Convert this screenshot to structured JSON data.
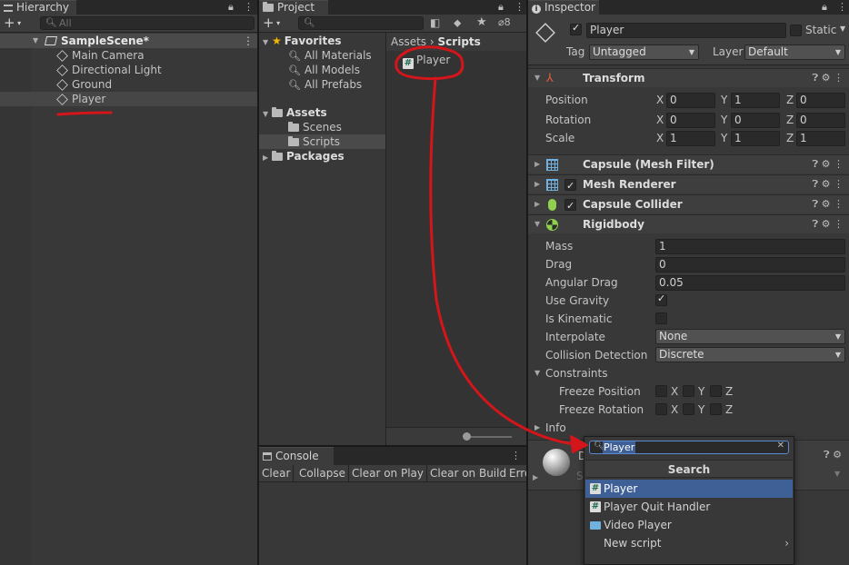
{
  "hierarchy": {
    "tab_label": "Hierarchy",
    "search_placeholder": "All",
    "scene_name": "SampleScene*",
    "items": [
      {
        "label": "Main Camera"
      },
      {
        "label": "Directional Light"
      },
      {
        "label": "Ground"
      },
      {
        "label": "Player"
      }
    ]
  },
  "project": {
    "tab_label": "Project",
    "hidden_count": "8",
    "favorites_label": "Favorites",
    "favorites": [
      {
        "label": "All Materials"
      },
      {
        "label": "All Models"
      },
      {
        "label": "All Prefabs"
      }
    ],
    "assets_label": "Assets",
    "asset_folders": [
      {
        "label": "Scenes"
      },
      {
        "label": "Scripts"
      }
    ],
    "packages_label": "Packages",
    "breadcrumb": {
      "root": "Assets",
      "sep": "›",
      "current": "Scripts"
    },
    "files": [
      {
        "label": "Player"
      }
    ]
  },
  "console": {
    "tab_label": "Console",
    "buttons": [
      "Clear",
      "Collapse",
      "Clear on Play",
      "Clear on Build",
      "Erro"
    ]
  },
  "inspector": {
    "tab_label": "Inspector",
    "object_name": "Player",
    "static_label": "Static",
    "tag_label": "Tag",
    "tag_value": "Untagged",
    "layer_label": "Layer",
    "layer_value": "Default",
    "transform": {
      "title": "Transform",
      "position_label": "Position",
      "rotation_label": "Rotation",
      "scale_label": "Scale",
      "position": {
        "x": "0",
        "y": "1",
        "z": "0"
      },
      "rotation": {
        "x": "0",
        "y": "0",
        "z": "0"
      },
      "scale": {
        "x": "1",
        "y": "1",
        "z": "1"
      }
    },
    "axis_labels": {
      "x": "X",
      "y": "Y",
      "z": "Z"
    },
    "components": [
      {
        "title": "Capsule (Mesh Filter)"
      },
      {
        "title": "Mesh Renderer"
      },
      {
        "title": "Capsule Collider"
      }
    ],
    "rigidbody": {
      "title": "Rigidbody",
      "mass_label": "Mass",
      "mass": "1",
      "drag_label": "Drag",
      "drag": "0",
      "angular_drag_label": "Angular Drag",
      "angular_drag": "0.05",
      "use_gravity_label": "Use Gravity",
      "is_kinematic_label": "Is Kinematic",
      "interpolate_label": "Interpolate",
      "interpolate": "None",
      "collision_detection_label": "Collision Detection",
      "collision_detection": "Discrete",
      "constraints_label": "Constraints",
      "freeze_position_label": "Freeze Position",
      "freeze_rotation_label": "Freeze Rotation",
      "info_label": "Info"
    },
    "material_partial": "D",
    "shader_partial": "S"
  },
  "add_component_popup": {
    "search_value": "Player",
    "header": "Search",
    "items": [
      {
        "label": "Player",
        "icon": "script-icon"
      },
      {
        "label": "Player Quit Handler",
        "icon": "script-icon"
      },
      {
        "label": "Video Player",
        "icon": "video-player-icon"
      },
      {
        "label": "New script",
        "icon": "chevron-right-icon"
      }
    ]
  },
  "annotation_color": "#d4151a",
  "selection_color": "#3e6096"
}
